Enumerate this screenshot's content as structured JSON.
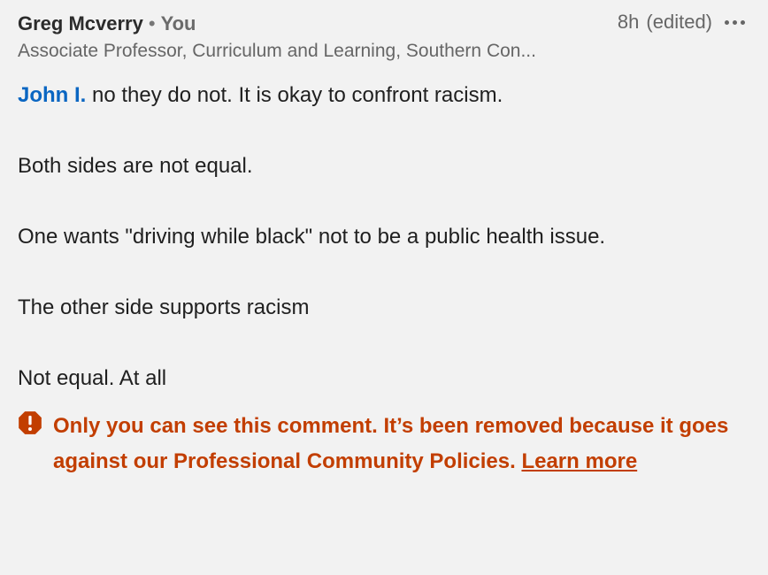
{
  "comment": {
    "author": "Greg Mcverry",
    "separator": "•",
    "you_label": "You",
    "time": "8h",
    "edited_label": "(edited)",
    "subtitle": "Associate Professor, Curriculum and Learning, Southern Con...",
    "mention": "John I.",
    "lines": [
      " no they do not. It is okay to confront racism.",
      "Both sides are not equal.",
      "One wants \"driving while black\" not to be a public health issue.",
      "The other side supports racism",
      "Not equal. At all"
    ]
  },
  "notice": {
    "text": "Only you can see this comment. It’s been removed because it goes against our Professional Community Policies. ",
    "link_label": "Learn more",
    "color": "#c23e00"
  },
  "colors": {
    "accent": "#0a66c2",
    "background": "#f2f2f2"
  }
}
